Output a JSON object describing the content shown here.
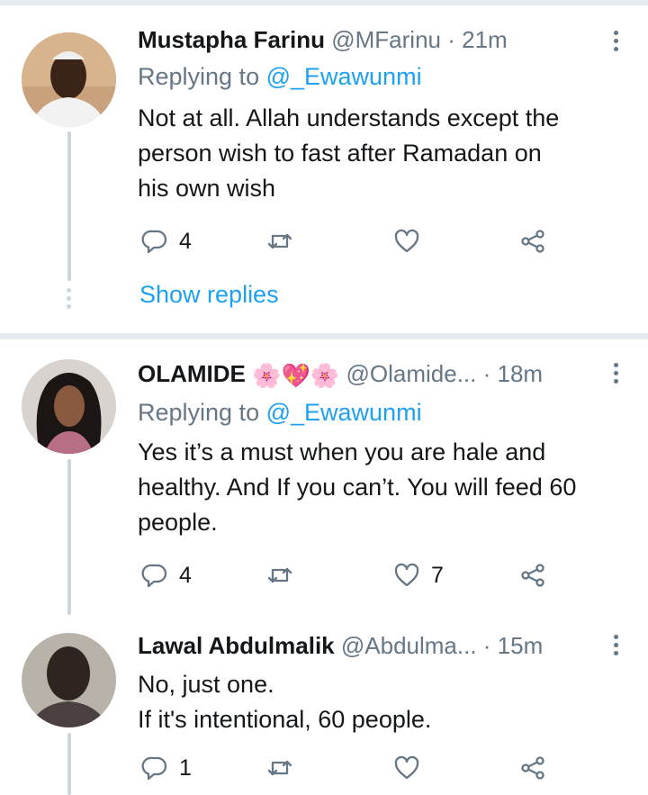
{
  "tweets": [
    {
      "name": "Mustapha Farinu",
      "handle": "@MFarinu",
      "time": "21m",
      "replying_prefix": "Replying to ",
      "replying_to": "@_Ewawunmi",
      "text": "Not at all. Allah understands except the\nperson wish to fast after Ramadan on\nhis own wish",
      "reply_count": "4",
      "retweet_count": "",
      "like_count": ""
    },
    {
      "name": "OLAMIDE",
      "name_emoji": "🌸💖🌸",
      "handle": "@Olamide...",
      "time": "18m",
      "replying_prefix": "Replying to ",
      "replying_to": "@_Ewawunmi",
      "text": "Yes it’s a must when you are hale and\nhealthy. And If you can’t. You will feed 60\npeople.",
      "reply_count": "4",
      "retweet_count": "",
      "like_count": "7"
    },
    {
      "name": "Lawal Abdulmalik",
      "handle": "@Abdulma...",
      "time": "15m",
      "text": "No, just one.\nIf it's intentional, 60 people.",
      "reply_count": "1",
      "retweet_count": "",
      "like_count": ""
    }
  ],
  "show_replies": "Show replies",
  "separator": " · ",
  "icons": {
    "reply": "reply-icon",
    "retweet": "retweet-icon",
    "like": "heart-icon",
    "share": "share-icon",
    "menu": "more-vertical-icon"
  },
  "colors": {
    "accent": "#1da1f2",
    "secondary_text": "#657786",
    "divider": "#e6ecf0",
    "thread_line": "#ccd6dd"
  }
}
